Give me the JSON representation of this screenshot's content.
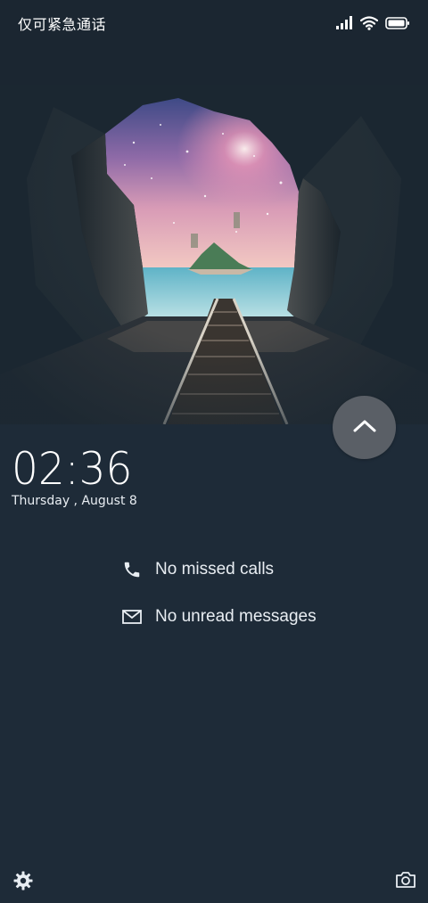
{
  "status_bar": {
    "emergency_label": "仅可紧急通话",
    "icons": [
      "signal-icon",
      "wifi-icon",
      "battery-icon"
    ]
  },
  "clock": {
    "time": "02:36",
    "date": "Thursday , August 8"
  },
  "notifications": {
    "calls": "No missed calls",
    "messages": "No unread messages"
  },
  "controls": {
    "unlock_icon": "chevron-up-icon",
    "settings_icon": "gear-icon",
    "camera_icon": "camera-icon"
  },
  "colors": {
    "background": "#1e2b38",
    "text": "#ffffff",
    "unlock_button": "#5a5f66"
  }
}
